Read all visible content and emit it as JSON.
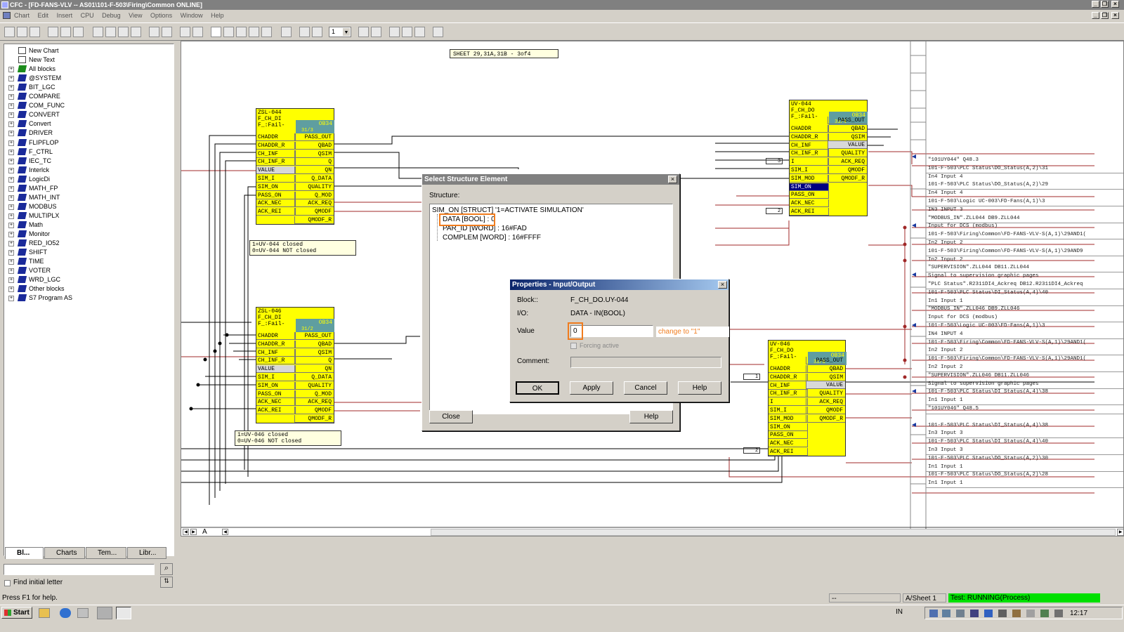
{
  "window": {
    "title": "CFC - [FD-FANS-VLV -- AS01\\101-F-503\\Firing\\Common  ONLINE]"
  },
  "menu": [
    "Chart",
    "Edit",
    "Insert",
    "CPU",
    "Debug",
    "View",
    "Options",
    "Window",
    "Help"
  ],
  "toolbar": {
    "zoom_value": "1"
  },
  "tree": {
    "items": [
      {
        "label": "New Chart",
        "icon": "chart-doc-icon"
      },
      {
        "label": "New Text",
        "icon": "text-doc-icon"
      },
      {
        "label": "All blocks",
        "icon": "all-blocks-icon"
      },
      {
        "label": "@SYSTEM",
        "icon": "block-folder-icon"
      },
      {
        "label": "BIT_LGC",
        "icon": "block-folder-icon"
      },
      {
        "label": "COMPARE",
        "icon": "block-folder-icon"
      },
      {
        "label": "COM_FUNC",
        "icon": "block-folder-icon"
      },
      {
        "label": "CONVERT",
        "icon": "block-folder-icon"
      },
      {
        "label": "Convert",
        "icon": "block-folder-icon"
      },
      {
        "label": "DRIVER",
        "icon": "block-folder-icon"
      },
      {
        "label": "FLIPFLOP",
        "icon": "block-folder-icon"
      },
      {
        "label": "F_CTRL",
        "icon": "block-folder-icon"
      },
      {
        "label": "IEC_TC",
        "icon": "block-folder-icon"
      },
      {
        "label": "Interlck",
        "icon": "block-folder-icon"
      },
      {
        "label": "LogicDi",
        "icon": "block-folder-icon"
      },
      {
        "label": "MATH_FP",
        "icon": "block-folder-icon"
      },
      {
        "label": "MATH_INT",
        "icon": "block-folder-icon"
      },
      {
        "label": "MODBUS",
        "icon": "block-folder-icon"
      },
      {
        "label": "MULTIPLX",
        "icon": "block-folder-icon"
      },
      {
        "label": "Math",
        "icon": "block-folder-icon"
      },
      {
        "label": "Monitor",
        "icon": "block-folder-icon"
      },
      {
        "label": "RED_IO52",
        "icon": "block-folder-icon"
      },
      {
        "label": "SHIFT",
        "icon": "block-folder-icon"
      },
      {
        "label": "TIME",
        "icon": "block-folder-icon"
      },
      {
        "label": "VOTER",
        "icon": "block-folder-icon"
      },
      {
        "label": "WRD_LGC",
        "icon": "block-folder-icon"
      },
      {
        "label": "Other blocks",
        "icon": "block-folder-icon"
      },
      {
        "label": "S7 Program AS",
        "icon": "s7-program-icon"
      }
    ],
    "tabs": [
      "Bl...",
      "Charts",
      "Tem...",
      "Libr..."
    ],
    "find_initial_letter": "Find initial letter"
  },
  "chart": {
    "sheet_label": "SHEET 29,31A,31B - 3of4",
    "sheet_tab": "A",
    "blocks": [
      {
        "name": "ZSL-044",
        "type": "F_CH_DI",
        "comment": "F_:Fail-",
        "ob": "OB34",
        "seq": "31/3",
        "inputs": [
          "CHADDR",
          "CHADDR_R",
          "CH_INF",
          "CH_INF_R",
          "VALUE",
          "SIM_I",
          "SIM_ON",
          "PASS_ON",
          "ACK_NEC",
          "ACK_REI"
        ],
        "outputs": [
          "PASS_OUT",
          "QBAD",
          "QSIM",
          "Q",
          "QN",
          "Q_DATA",
          "QUALITY",
          "Q_MOD",
          "ACK_REQ",
          "QMODF",
          "QMODF_R"
        ]
      },
      {
        "name": "ZSL-046",
        "type": "F_CH_DI",
        "comment": "F_:Fail-",
        "ob": "OB34",
        "seq": "31/2",
        "inputs": [
          "CHADDR",
          "CHADDR_R",
          "CH_INF",
          "CH_INF_R",
          "VALUE",
          "SIM_I",
          "SIM_ON",
          "PASS_ON",
          "ACK_NEC",
          "ACK_REI"
        ],
        "outputs": [
          "PASS_OUT",
          "QBAD",
          "QSIM",
          "Q",
          "QN",
          "Q_DATA",
          "QUALITY",
          "Q_MOD",
          "ACK_REQ",
          "QMODF",
          "QMODF_R"
        ]
      },
      {
        "name": "UV-044",
        "type": "F_CH_DO",
        "comment": "F_:Fail-",
        "ob": "OB34",
        "seq": "31/4",
        "inputs": [
          "CHADDR",
          "CHADDR_R",
          "CH_INF",
          "CH_INF_R",
          "I",
          "SIM_I",
          "SIM_MOD",
          "SIM_ON",
          "PASS_ON",
          "ACK_NEC",
          "ACK_REI"
        ],
        "outputs": [
          "PASS_OUT",
          "QBAD",
          "QSIM",
          "VALUE",
          "QUALITY",
          "ACK_REQ",
          "QMODF",
          "QMODF_R"
        ]
      },
      {
        "name": "UV-046",
        "type": "F_CH_DO",
        "comment": "F_:Fail-",
        "ob": "OB34",
        "seq": "31/6",
        "inputs": [
          "CHADDR",
          "CHADDR_R",
          "CH_INF",
          "CH_INF_R",
          "I",
          "SIM_I",
          "SIM_MOD",
          "SIM_ON",
          "PASS_ON",
          "ACK_NEC",
          "ACK_REI"
        ],
        "outputs": [
          "PASS_OUT",
          "QBAD",
          "QSIM",
          "VALUE",
          "QUALITY",
          "ACK_REQ",
          "QMODF",
          "QMODF_R"
        ]
      }
    ],
    "notes": [
      "1=UV-044 closed\n0=UV-044 NOT closed",
      "1=UV-046 closed\n0=UV-046 NOT closed"
    ],
    "constants": [
      "3",
      "2",
      "1",
      "2",
      "0"
    ],
    "margin_refs": [
      "\"101UY044\" Q48.3",
      "101-F-503\\PLC Status\\DO_Status(A,2)\\31",
      "In4 Input 4",
      "101-F-503\\PLC Status\\DO_Status(A,2)\\29",
      "In4 Input 4",
      "101-F-503\\Logic UC-003\\FD-Fans(A,1)\\3",
      "IN3  INPUT 3",
      "\"MODBUS_IN\".ZLL044 DB9.ZLL044",
      "Input for DCS (modbus)",
      "101-F-503\\Firing\\Common\\FD-FANS-VLV-S(A,1)\\29AND1(",
      "In2 Input 2",
      "101-F-503\\Firing\\Common\\FD-FANS-VLV-S(A,1)\\29AND9",
      "In2 Input 2",
      "\"SUPERVISION\".ZLL044 DB11.ZLL044",
      "Signal to supervision graphic pages",
      "\"PLC Status\".R2311DI4_Ackreq DB12.R2311DI4_Ackreq",
      "101-F-503\\PLC Status\\DI_Status(A,4)\\40",
      "In1 Input 1",
      "\"MODBUS_IN\".ZLL046 DB9.ZLL046",
      "Input for DCS (modbus)",
      "101-F-503\\Logic UC-003\\FD-Fans(A,1)\\3",
      "IN4  INPUT 4",
      "101-F-503\\Firing\\Common\\FD-FANS-VLV-S(A,1)\\29AND1(",
      "In2 Input 2",
      "101-F-503\\Firing\\Common\\FD-FANS-VLV-S(A,1)\\29AND1(",
      "In2 Input 2",
      "\"SUPERVISION\".ZLL046 DB11.ZLL046",
      "Signal to supervision graphic pages",
      "101-F-503\\PLC Status\\DI_Status(A,4)\\38",
      "In1 Input 1",
      "\"101UY046\" Q48.5",
      "",
      "101-F-503\\PLC Status\\DI_Status(A,4)\\38",
      "In3 Input 3",
      "101-F-503\\PLC Status\\DI_Status(A,4)\\40",
      "In3 Input 3",
      "101-F-503\\PLC Status\\DO_Status(A,2)\\30",
      "In1 Input 1",
      "101-F-503\\PLC Status\\DO_Status(A,2)\\28",
      "In1 Input 1"
    ]
  },
  "select_structure_dialog": {
    "title": "Select Structure Element",
    "structure_label": "Structure:",
    "root": "SIM_ON [STRUCT] '1=ACTIVATE SIMULATION'",
    "items": [
      "DATA [BOOL] : 0",
      "PAR_ID [WORD] : 16#FAD",
      "COMPLEM [WORD] : 16#FFFF"
    ],
    "close_label": "Close",
    "help_label": "Help"
  },
  "properties_dialog": {
    "title": "Properties - Input/Output",
    "block_label": "Block::",
    "block_value": "F_CH_DO.UY-044",
    "io_label": "I/O:",
    "io_value": "DATA - IN(BOOL)",
    "value_label": "Value",
    "value": "0",
    "annotation": "change to \"1\"",
    "forcing_label": "Forcing active",
    "comment_label": "Comment:",
    "comment_value": "",
    "ok_label": "OK",
    "apply_label": "Apply",
    "cancel_label": "Cancel",
    "help_label": "Help"
  },
  "statusbar": {
    "help_text": "Press F1 for help.",
    "field2": "--",
    "sheet": "A/Sheet 1",
    "test_status": "Test: RUNNING(Process)",
    "test_color": "#00e000"
  },
  "taskbar": {
    "start_label": "Start",
    "lang": "IN",
    "clock": "12:17"
  },
  "colors": {
    "block": "#ffff00",
    "ob_header": "#5f9ea0",
    "highlight": "#f07c1e",
    "wire_red": "#a02828",
    "title_inactive": "#808080",
    "dialog_title": "#0a246a"
  }
}
